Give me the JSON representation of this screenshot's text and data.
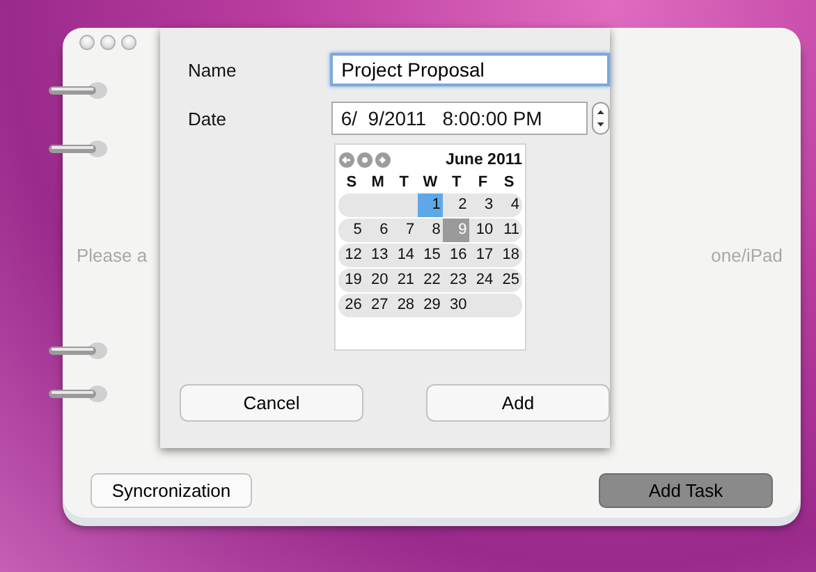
{
  "notebook": {
    "message_left": "Please a",
    "message_right": "one/iPad",
    "buttons": [
      {
        "label": "Syncronization",
        "kind": "plain"
      },
      {
        "label": "Add Task",
        "kind": "dark"
      }
    ]
  },
  "dialog": {
    "name_label": "Name",
    "name_value": "Project Proposal",
    "date_label": "Date",
    "date_value": "6/  9/2011   8:00:00 PM",
    "calendar": {
      "month": "June 2011",
      "weekdays": [
        "S",
        "M",
        "T",
        "W",
        "T",
        "F",
        "S"
      ],
      "weeks": [
        {
          "kind": "first",
          "days": [
            {
              "day": "1",
              "selected": true,
              "today": false
            },
            {
              "day": "2",
              "selected": false,
              "today": false
            },
            {
              "day": "3",
              "selected": false,
              "today": false
            },
            {
              "day": "4",
              "selected": false,
              "today": false
            }
          ]
        },
        {
          "kind": "full",
          "days": [
            {
              "day": "5",
              "selected": false,
              "today": false
            },
            {
              "day": "6",
              "selected": false,
              "today": false
            },
            {
              "day": "7",
              "selected": false,
              "today": false
            },
            {
              "day": "8",
              "selected": false,
              "today": false
            },
            {
              "day": "9",
              "selected": false,
              "today": true
            },
            {
              "day": "10",
              "selected": false,
              "today": false
            },
            {
              "day": "11",
              "selected": false,
              "today": false
            }
          ]
        },
        {
          "kind": "full",
          "days": [
            {
              "day": "12",
              "selected": false,
              "today": false
            },
            {
              "day": "13",
              "selected": false,
              "today": false
            },
            {
              "day": "14",
              "selected": false,
              "today": false
            },
            {
              "day": "15",
              "selected": false,
              "today": false
            },
            {
              "day": "16",
              "selected": false,
              "today": false
            },
            {
              "day": "17",
              "selected": false,
              "today": false
            },
            {
              "day": "18",
              "selected": false,
              "today": false
            }
          ]
        },
        {
          "kind": "full",
          "days": [
            {
              "day": "19",
              "selected": false,
              "today": false
            },
            {
              "day": "20",
              "selected": false,
              "today": false
            },
            {
              "day": "21",
              "selected": false,
              "today": false
            },
            {
              "day": "22",
              "selected": false,
              "today": false
            },
            {
              "day": "23",
              "selected": false,
              "today": false
            },
            {
              "day": "24",
              "selected": false,
              "today": false
            },
            {
              "day": "25",
              "selected": false,
              "today": false
            }
          ]
        },
        {
          "kind": "last",
          "days": [
            {
              "day": "26",
              "selected": false,
              "today": false
            },
            {
              "day": "27",
              "selected": false,
              "today": false
            },
            {
              "day": "28",
              "selected": false,
              "today": false
            },
            {
              "day": "29",
              "selected": false,
              "today": false
            },
            {
              "day": "30",
              "selected": false,
              "today": false
            }
          ]
        }
      ]
    },
    "buttons": [
      "Cancel",
      "Add"
    ]
  }
}
